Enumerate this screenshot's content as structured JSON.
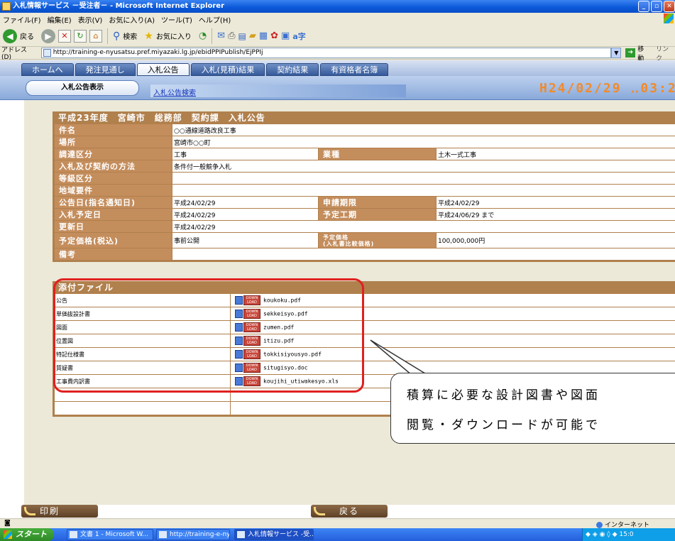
{
  "window": {
    "title": "入札情報サービス －受注者－ - Microsoft Internet Explorer"
  },
  "menu": [
    "ファイル(F)",
    "編集(E)",
    "表示(V)",
    "お気に入り(A)",
    "ツール(T)",
    "ヘルプ(H)"
  ],
  "toolbar": {
    "back_label": "戻る",
    "search_label": "検索",
    "favorites_label": "お気に入り"
  },
  "address": {
    "label": "アドレス(D)",
    "url": "http://training-e-nyusatsu.pref.miyazaki.lg.jp/ebidPPIPublish/EjPPIj",
    "go_label": "移動",
    "links_label": "リンク"
  },
  "nav": {
    "tabs": [
      {
        "label": "ホームへ"
      },
      {
        "label": "発注見通し"
      },
      {
        "label": "入札公告"
      },
      {
        "label": "入札(見積)結果"
      },
      {
        "label": "契約結果"
      },
      {
        "label": "有資格者名簿"
      }
    ],
    "subtab": "入札公告表示",
    "sublink": "入札公告検索",
    "datetime": "H24/02/29 ‥03:2"
  },
  "notice": {
    "header": "平成23年度　宮崎市　総務部　契約課　入札公告",
    "rows": [
      {
        "label": "件名",
        "value": "○○通線道路改良工事"
      },
      {
        "label": "場所",
        "value": "宮崎市○○町"
      },
      {
        "label": "調達区分",
        "value": "工事",
        "label2": "業種",
        "value2": "土木一式工事"
      },
      {
        "label": "入札及び契約の方法",
        "value": "条件付一般競争入札"
      },
      {
        "label": "等級区分",
        "value": ""
      },
      {
        "label": "地域要件",
        "value": ""
      },
      {
        "label": "公告日(指名通知日)",
        "value": "平成24/02/29",
        "label2": "申請期限",
        "value2": "平成24/02/29"
      },
      {
        "label": "入札予定日",
        "value": "平成24/02/29",
        "label2": "予定工期",
        "value2": "平成24/06/29 まで"
      },
      {
        "label": "更新日",
        "value": "平成24/02/29"
      },
      {
        "label": "予定価格(税込)",
        "value": "事前公開",
        "label2": "予定価格\n(入札書比較価格)",
        "value2": "100,000,000円"
      },
      {
        "label": "備考",
        "value": ""
      }
    ]
  },
  "attachments": {
    "header": "添付ファイル",
    "download_label": "DOWN LOAD",
    "files": [
      {
        "name": "公告",
        "file": "koukoku.pdf"
      },
      {
        "name": "単価抜設計書",
        "file": "sekkeisyo.pdf"
      },
      {
        "name": "図面",
        "file": "zumen.pdf"
      },
      {
        "name": "位置図",
        "file": "itizu.pdf"
      },
      {
        "name": "特記仕様書",
        "file": "tokkisiyousyo.pdf"
      },
      {
        "name": "質疑書",
        "file": "situgisyo.doc"
      },
      {
        "name": "工事費内訳書",
        "file": "koujihi_utiwakesyo.xls"
      },
      {
        "name": "",
        "file": ""
      },
      {
        "name": "",
        "file": ""
      }
    ]
  },
  "callout": {
    "line1": "積算に必要な設計図書や図面",
    "line2": "閲覧・ダウンロードが可能で"
  },
  "buttons": {
    "print": "印刷",
    "back": "戻る"
  },
  "status": {
    "zone": "インターネット"
  },
  "taskbar": {
    "start": "スタート",
    "items": [
      {
        "label": "文書 1 - Microsoft W..."
      },
      {
        "label": "http://training-e-nyu..."
      },
      {
        "label": "入札情報サービス -受..."
      }
    ],
    "clock": "15:0"
  },
  "colors": {
    "panel_brown": "#b0804d",
    "label_brown": "#c48d5c",
    "highlight_red": "#e02020",
    "date_orange": "#f28a2a"
  }
}
